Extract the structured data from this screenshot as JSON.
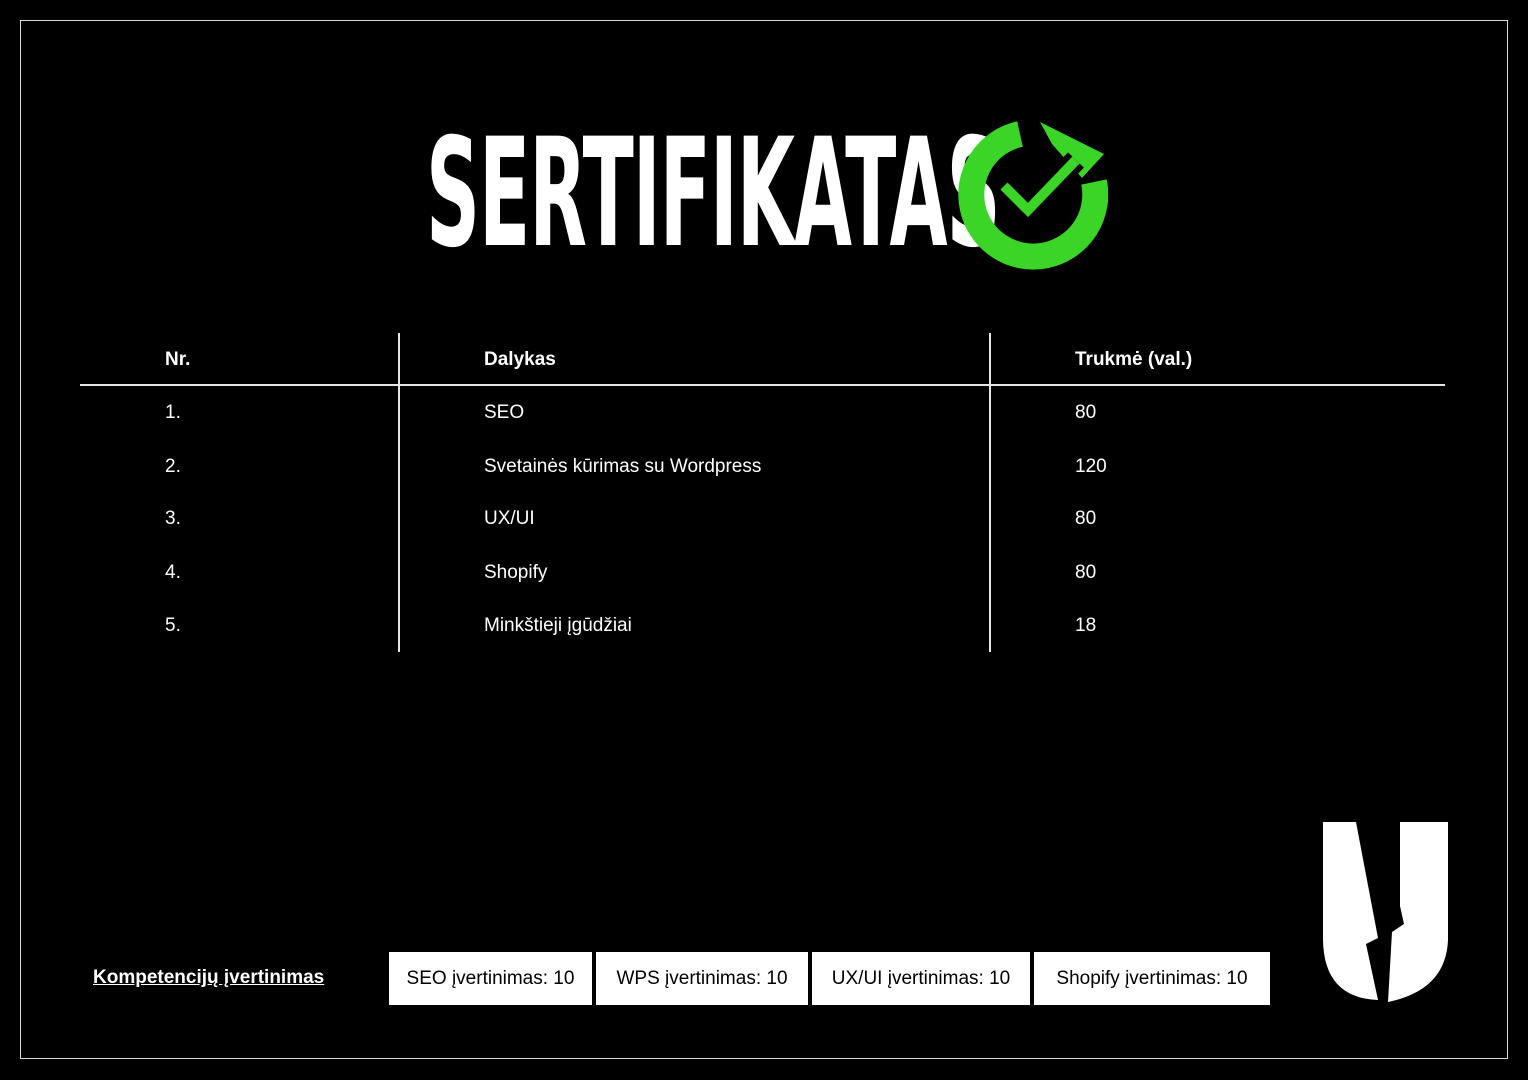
{
  "title": "SERTIFIKATAS",
  "accent_color": "#3ad526",
  "badge_icon": "check-circle-icon",
  "table": {
    "headers": [
      "Nr.",
      "Dalykas",
      "Trukmė (val.)"
    ],
    "rows": [
      {
        "nr": "1.",
        "subject": "SEO",
        "hours": "80"
      },
      {
        "nr": "2.",
        "subject": "Svetainės kūrimas su Wordpress",
        "hours": "120"
      },
      {
        "nr": "3.",
        "subject": "UX/UI",
        "hours": "80"
      },
      {
        "nr": "4.",
        "subject": "Shopify",
        "hours": "80"
      },
      {
        "nr": "5.",
        "subject": "Minkštieji įgūdžiai",
        "hours": "18"
      }
    ]
  },
  "competency": {
    "label": "Kompetencijų įvertinimas",
    "scores": [
      "SEO įvertinimas: 10",
      "WPS įvertinimas: 10",
      "UX/UI įvertinimas: 10",
      "Shopify įvertinimas: 10"
    ]
  },
  "logo_icon": "brand-logo-icon"
}
